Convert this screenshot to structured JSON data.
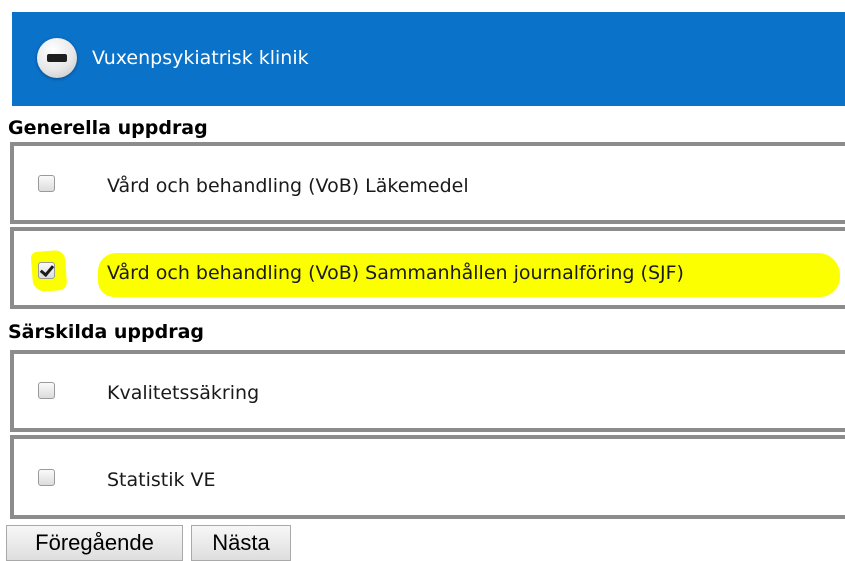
{
  "header": {
    "collapse_icon": "minus-circle-icon",
    "title": "Vuxenpsykiatrisk klinik",
    "background_color": "#0a72c9"
  },
  "sections": [
    {
      "heading": "Generella uppdrag",
      "options": [
        {
          "label": "Vård och behandling (VoB) Läkemedel",
          "checked": false
        },
        {
          "label": "Vård och behandling (VoB) Sammanhållen journalföring (SJF)",
          "checked": true,
          "highlighted": true,
          "highlight_color": "#fbff00"
        }
      ]
    },
    {
      "heading": "Särskilda uppdrag",
      "options": [
        {
          "label": "Kvalitetssäkring",
          "checked": false
        },
        {
          "label": "Statistik VE",
          "checked": false
        }
      ]
    }
  ],
  "buttons": {
    "previous_label": "Föregående",
    "next_label": "Nästa"
  }
}
